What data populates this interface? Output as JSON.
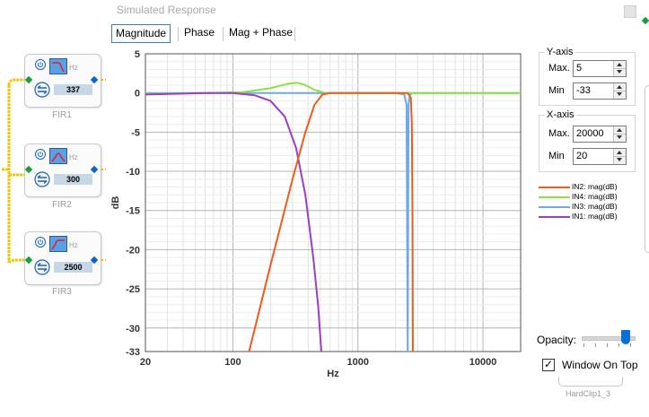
{
  "dialog": {
    "title": "Simulated Response",
    "tabs": [
      {
        "label": "Magnitude",
        "active": true
      },
      {
        "label": "Phase",
        "active": false
      },
      {
        "label": "Mag + Phase",
        "active": false
      }
    ]
  },
  "yaxis_group": {
    "title": "Y-axis",
    "max_label": "Max.",
    "max_value": "5",
    "min_label": "Min",
    "min_value": "-33"
  },
  "xaxis_group": {
    "title": "X-axis",
    "max_label": "Max.",
    "max_value": "20000",
    "min_label": "Min",
    "min_value": "20"
  },
  "opacity": {
    "label": "Opacity:",
    "value_fraction": 0.85
  },
  "window_on_top": {
    "label": "Window On Top",
    "checked": true
  },
  "canvas": {
    "blocks": [
      {
        "value": "337",
        "label": "FIR1",
        "hz": "Hz"
      },
      {
        "value": "300",
        "label": "FIR2",
        "hz": "Hz"
      },
      {
        "value": "2500",
        "label": "FIR3",
        "hz": "Hz"
      }
    ],
    "bottom_label": "HardClip1_3"
  },
  "chart_data": {
    "type": "line",
    "xlabel": "Hz",
    "ylabel": "dB",
    "xscale": "log",
    "xlim": [
      20,
      20000
    ],
    "ylim": [
      -33,
      5
    ],
    "xticks": [
      20,
      100,
      1000,
      10000
    ],
    "xtick_labels": [
      "20",
      "100",
      "1000",
      "10000"
    ],
    "yticks": [
      5,
      0,
      -5,
      -10,
      -15,
      -20,
      -25,
      -30,
      -33
    ],
    "ytick_labels": [
      "5",
      "0",
      "-5",
      "-10",
      "-15",
      "-20",
      "-25",
      "-30",
      "-33"
    ],
    "grid": true,
    "legend_position": "right",
    "series": [
      {
        "name": "IN2: mag(dB)",
        "color": "#f05a1a",
        "x": [
          135,
          200,
          300,
          380,
          450,
          520,
          600,
          1000,
          2000,
          2500,
          2650,
          2700,
          2730,
          2750
        ],
        "y": [
          -33,
          -22,
          -11,
          -5,
          -1.5,
          -0.2,
          0,
          0,
          0,
          0,
          -0.6,
          -4,
          -15,
          -33
        ]
      },
      {
        "name": "IN4: mag(dB)",
        "color": "#8fe040",
        "x": [
          20,
          60,
          120,
          200,
          280,
          330,
          380,
          450,
          550,
          1000,
          20000
        ],
        "y": [
          -0.1,
          0,
          0.1,
          0.6,
          1.2,
          1.3,
          1.0,
          0.4,
          0,
          0,
          0
        ]
      },
      {
        "name": "IN3: mag(dB)",
        "color": "#6fa8e8",
        "x": [
          20,
          1000,
          2000,
          2350,
          2450,
          2500,
          2540,
          2600,
          2700,
          3000,
          20000
        ],
        "y": [
          0,
          0,
          0,
          -0.2,
          -1.5,
          -33,
          -1.5,
          -0.3,
          0,
          0,
          0
        ]
      },
      {
        "name": "IN1: mag(dB)",
        "color": "#9a3fc4",
        "x": [
          20,
          60,
          100,
          150,
          200,
          260,
          320,
          380,
          440,
          480,
          510
        ],
        "y": [
          -0.2,
          0,
          0,
          -0.3,
          -1,
          -3,
          -7,
          -13,
          -21,
          -27,
          -33
        ]
      }
    ]
  }
}
